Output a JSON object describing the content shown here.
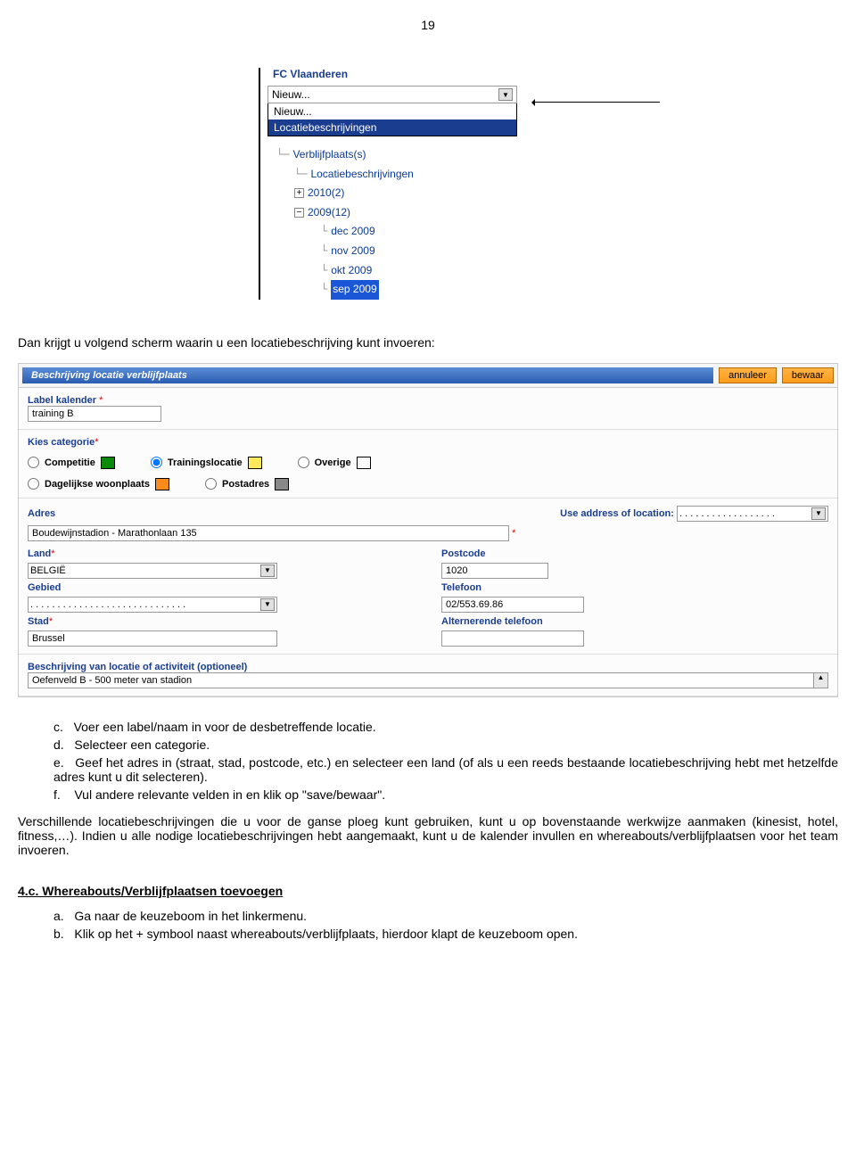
{
  "page_number": "19",
  "tree": {
    "title": "FC Vlaanderen",
    "dropdown_value": "Nieuw...",
    "dropdown_items": [
      "Nieuw...",
      "Locatiebeschrijvingen"
    ],
    "nodes": {
      "root": "Verblijfplaats(s)",
      "loc": "Locatiebeschrijvingen",
      "y2010_label": "2010(2)",
      "y2009_label": "2009(12)",
      "months": [
        "dec 2009",
        "nov 2009",
        "okt 2009",
        "sep 2009"
      ]
    }
  },
  "intro_text": "Dan krijgt u volgend scherm waarin u een locatiebeschrijving kunt invoeren:",
  "form": {
    "header_title": "Beschrijving locatie verblijfplaats",
    "btn_cancel": "annuleer",
    "btn_save": "bewaar",
    "label_kalender": "Label kalender",
    "label_value": "training B",
    "kies_categorie": "Kies categorie",
    "cat_competitie": "Competitie",
    "cat_training": "Trainingslocatie",
    "cat_overige": "Overige",
    "cat_dagelijkse": "Dagelijkse woonplaats",
    "cat_postadres": "Postadres",
    "adres_label": "Adres",
    "use_loc_label": "Use address of location:",
    "use_loc_value": ". . . . . . . . . . . . . . . . . .",
    "adres_value": "Boudewijnstadion - Marathonlaan 135",
    "land_label": "Land",
    "land_value": "BELGIË",
    "gebied_label": "Gebied",
    "gebied_value": ". . . . . . . . . . . . . . . . . . . . . . . . . . . . .",
    "stad_label": "Stad",
    "stad_value": "Brussel",
    "postcode_label": "Postcode",
    "postcode_value": "1020",
    "telefoon_label": "Telefoon",
    "telefoon_value": "02/553.69.86",
    "alt_tel_label": "Alternerende telefoon",
    "beschrijving_label": "Beschrijving van locatie of activiteit (optioneel)",
    "beschrijving_value": "Oefenveld B - 500 meter van stadion"
  },
  "doc": {
    "list_c": "Voer een label/naam in voor de desbetreffende locatie.",
    "list_d": "Selecteer een categorie.",
    "list_e": "Geef het adres in (straat, stad, postcode, etc.) en selecteer een land (of als u een reeds bestaande locatiebeschrijving hebt met hetzelfde adres kunt u dit selecteren).",
    "list_f": "Vul andere relevante velden in en klik op \"save/bewaar\".",
    "para": "Verschillende locatiebeschrijvingen die u voor de ganse ploeg kunt gebruiken, kunt u op bovenstaande werkwijze aanmaken (kinesist, hotel, fitness,…). Indien u alle nodige locatiebeschrijvingen hebt aangemaakt, kunt u de kalender invullen en whereabouts/verblijfplaatsen voor het team invoeren.",
    "sec_title": "4.c. Whereabouts/Verblijfplaatsen toevoegen",
    "sub_a": "Ga naar de keuzeboom in het linkermenu.",
    "sub_b": "Klik op het + symbool naast whereabouts/verblijfplaats, hierdoor klapt de keuzeboom open."
  }
}
